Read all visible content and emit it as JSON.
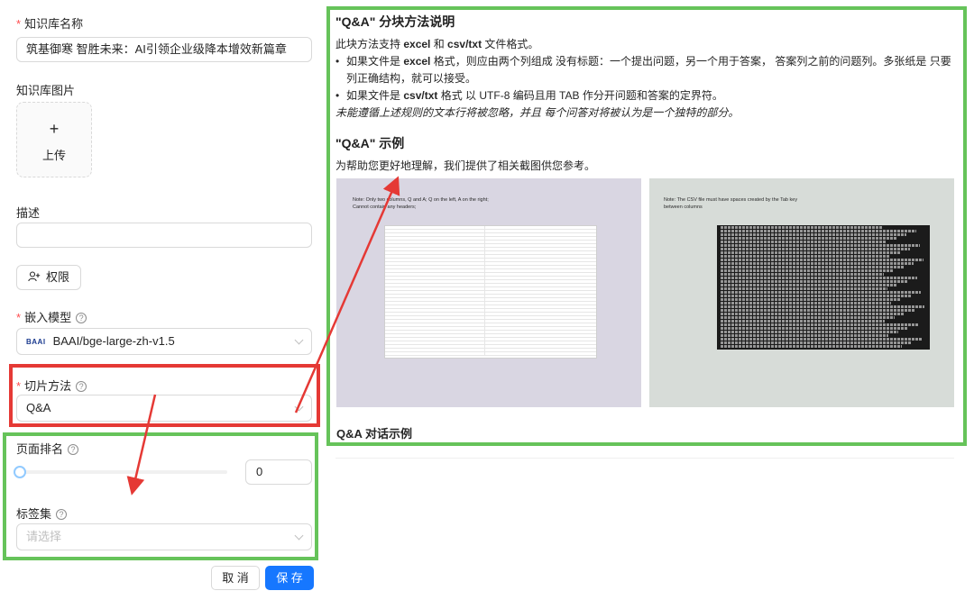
{
  "form": {
    "kb_name_label": "知识库名称",
    "kb_name_value": "筑基御寒 智胜未来：AI引领企业级降本增效新篇章",
    "kb_image_label": "知识库图片",
    "upload_plus": "+",
    "upload_label": "上传",
    "desc_label": "描述",
    "desc_value": "",
    "permission_label": "权限",
    "embed_model_label": "嵌入模型",
    "embed_model_value": "BAAI/bge-large-zh-v1.5",
    "embed_model_logo": "BAAI",
    "chunk_method_label": "切片方法",
    "chunk_method_value": "Q&A",
    "page_rank_label": "页面排名",
    "page_rank_value": "0",
    "page_rank_slider": 0,
    "tags_label": "标签集",
    "tags_placeholder": "请选择",
    "cancel_label": "取 消",
    "save_label": "保 存",
    "help_glyph": "?"
  },
  "panel": {
    "title": "\"Q&A\" 分块方法说明",
    "support_prefix": "此块方法支持 ",
    "support_excel": "excel",
    "support_and": " 和 ",
    "support_csv": "csv/txt",
    "support_suffix": " 文件格式。",
    "bullet1_prefix": "如果文件是 ",
    "bullet1_bold": "excel",
    "bullet1_text": " 格式，则应由两个列组成 没有标题：一个提出问题，另一个用于答案， 答案列之前的问题列。多张纸是 只要列正确结构，就可以接受。",
    "bullet2_prefix": "如果文件是 ",
    "bullet2_bold": "csv/txt",
    "bullet2_text": " 格式 以 UTF-8 编码且用 TAB 作分开问题和答案的定界符。",
    "italic_note": "未能遵循上述规则的文本行将被忽略，并且 每个问答对将被认为是一个独特的部分。",
    "example_title": "\"Q&A\" 示例",
    "example_desc": "为帮助您更好地理解，我们提供了相关截图供您参考。",
    "img1_note_line1": "Note: Only two columns, Q and A; Q on the left, A on the right;",
    "img1_note_line2": "Cannot contain any headers;",
    "img2_note_line1": "Note: The CSV file must have spaces created by the Tab key",
    "img2_note_line2": "between columns",
    "dialog_example_title": "Q&A 对话示例"
  },
  "colors": {
    "highlight_red": "#e53935",
    "highlight_green": "#66c35a",
    "primary": "#1677ff"
  }
}
